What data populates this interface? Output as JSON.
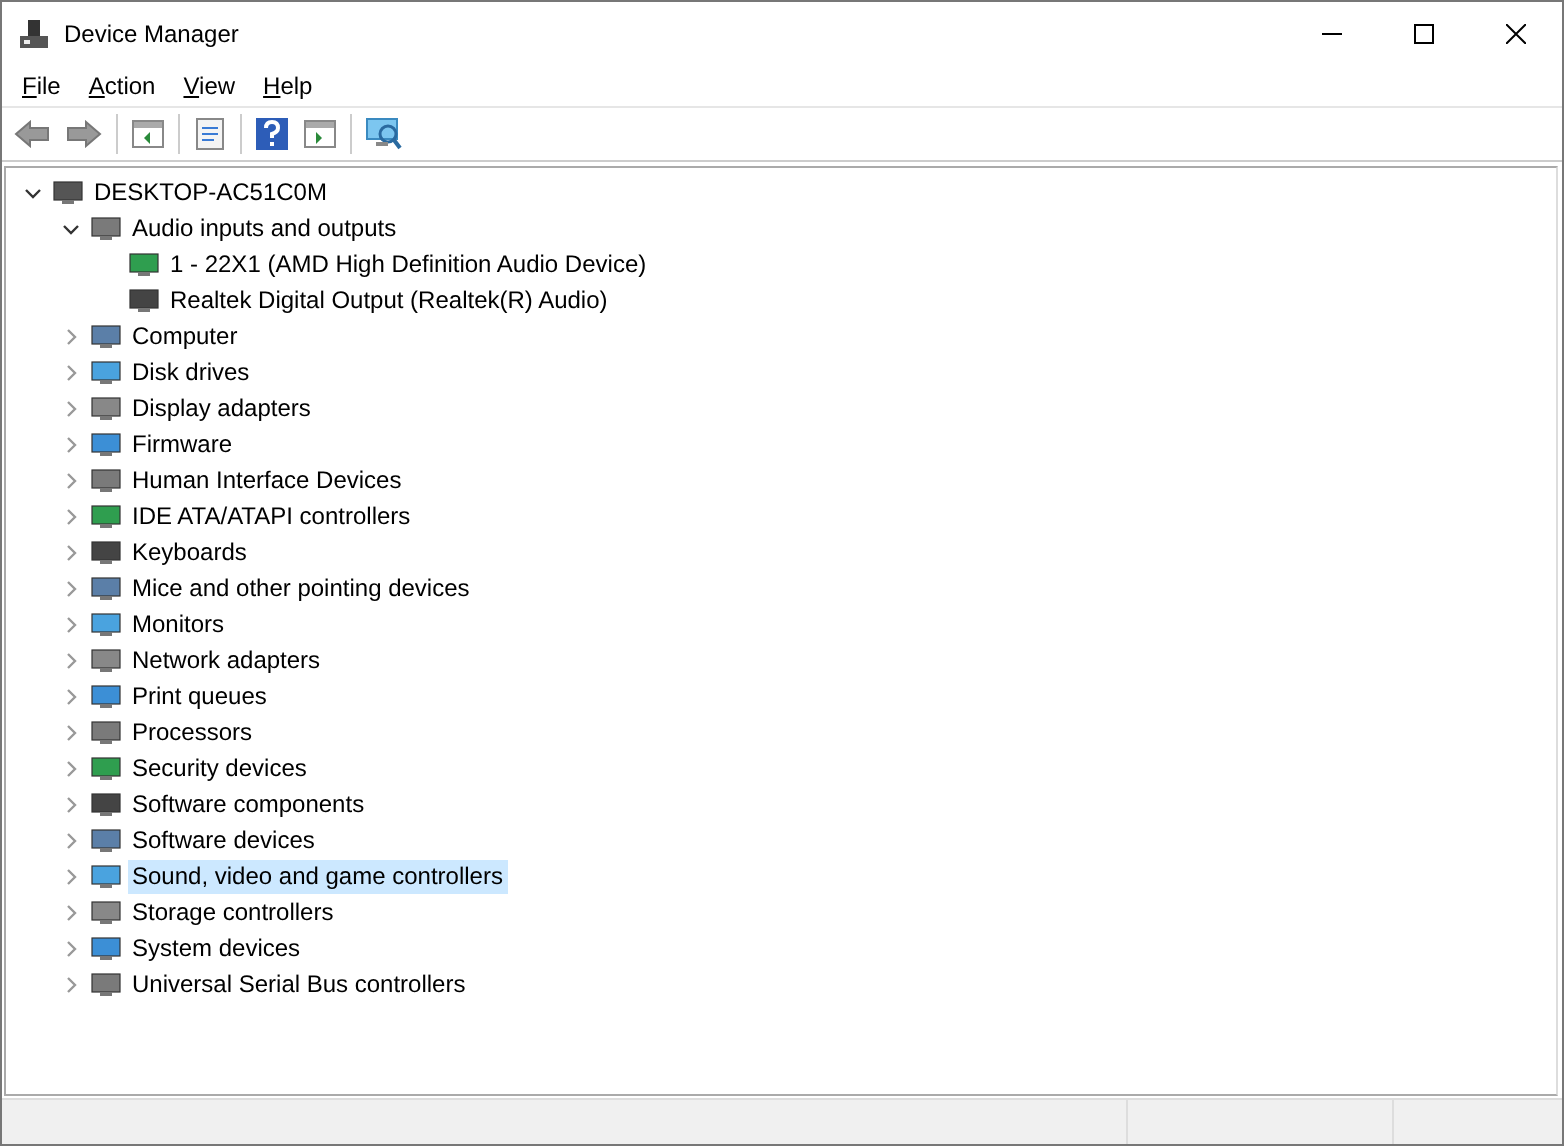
{
  "window": {
    "title": "Device Manager"
  },
  "menu": [
    "File",
    "Action",
    "View",
    "Help"
  ],
  "tree": [
    {
      "label": "DESKTOP-AC51C0M",
      "expanded": true,
      "selected": false,
      "children": [
        {
          "label": "Audio inputs and outputs",
          "expanded": true,
          "selected": false,
          "children": [
            {
              "label": "1 - 22X1 (AMD High Definition Audio Device)",
              "selected": false
            },
            {
              "label": "Realtek Digital Output (Realtek(R) Audio)",
              "selected": false
            }
          ]
        },
        {
          "label": "Computer",
          "expanded": false,
          "selected": false
        },
        {
          "label": "Disk drives",
          "expanded": false,
          "selected": false
        },
        {
          "label": "Display adapters",
          "expanded": false,
          "selected": false
        },
        {
          "label": "Firmware",
          "expanded": false,
          "selected": false
        },
        {
          "label": "Human Interface Devices",
          "expanded": false,
          "selected": false
        },
        {
          "label": "IDE ATA/ATAPI controllers",
          "expanded": false,
          "selected": false
        },
        {
          "label": "Keyboards",
          "expanded": false,
          "selected": false
        },
        {
          "label": "Mice and other pointing devices",
          "expanded": false,
          "selected": false
        },
        {
          "label": "Monitors",
          "expanded": false,
          "selected": false
        },
        {
          "label": "Network adapters",
          "expanded": false,
          "selected": false
        },
        {
          "label": "Print queues",
          "expanded": false,
          "selected": false
        },
        {
          "label": "Processors",
          "expanded": false,
          "selected": false
        },
        {
          "label": "Security devices",
          "expanded": false,
          "selected": false
        },
        {
          "label": "Software components",
          "expanded": false,
          "selected": false
        },
        {
          "label": "Software devices",
          "expanded": false,
          "selected": false
        },
        {
          "label": "Sound, video and game controllers",
          "expanded": false,
          "selected": true
        },
        {
          "label": "Storage controllers",
          "expanded": false,
          "selected": false
        },
        {
          "label": "System devices",
          "expanded": false,
          "selected": false
        },
        {
          "label": "Universal Serial Bus controllers",
          "expanded": false,
          "selected": false
        }
      ]
    }
  ]
}
